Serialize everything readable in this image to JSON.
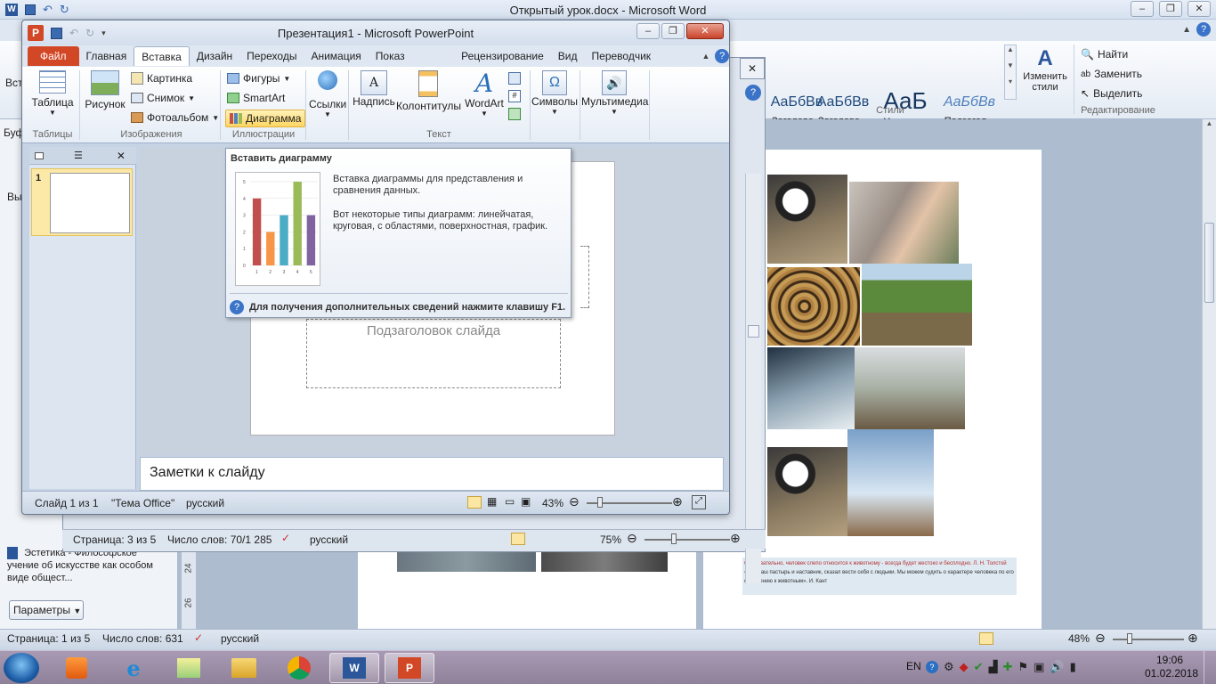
{
  "word": {
    "title": "Открытый урок.docx  -  Microsoft Word",
    "styles": [
      {
        "sample": "АаБбВв",
        "label": "Заголово..."
      },
      {
        "sample": "АаБбВв",
        "label": "Заголово..."
      },
      {
        "sample": "АаБ",
        "label": "Название"
      },
      {
        "sample": "АаБбВв",
        "label": "Подзагол..."
      }
    ],
    "styles_group": "Стили",
    "change_styles": "Изменить стили",
    "edit_group": "Редактирование",
    "find": "Найти",
    "replace": "Заменить",
    "select": "Выделить",
    "left_partial_1": "Вст",
    "left_partial_2": "Буф",
    "left_partial_3": "Вы",
    "nav_item": "Эстетика - Философское учение об искусстве как особом виде общест...",
    "params_button": "Параметры",
    "ruler_marks": [
      "24",
      "26"
    ],
    "quote_line1": "Следовательно, человек слепо относится к животному - всегда будет жестоко и бесплодно. Л. Н. Толстой",
    "quote_line2": "«Бог, наш пастырь и наставник, сказал вести себя с людьми. Мы можем судить о характере человека по его отношению к животным». И. Кант",
    "status": {
      "page": "Страница: 1 из 5",
      "words": "Число слов: 631",
      "lang": "русский",
      "zoom": "48%"
    }
  },
  "mid_word": {
    "status": {
      "page": "Страница: 3 из 5",
      "words": "Число слов: 70/1 285",
      "lang": "русский",
      "zoom": "75%"
    }
  },
  "ppt": {
    "title": "Презентация1  -  Microsoft PowerPoint",
    "app_letter": "P",
    "tabs": [
      "Файл",
      "Главная",
      "Вставка",
      "Дизайн",
      "Переходы",
      "Анимация",
      "Показ слайдов",
      "Рецензирование",
      "Вид",
      "Переводчик PROMT"
    ],
    "active_tab": "Вставка",
    "ribbon": {
      "table": "Таблица",
      "tables_group": "Таблицы",
      "picture": "Рисунок",
      "clipart": "Картинка",
      "screenshot": "Снимок",
      "photoalbum": "Фотоальбом",
      "images_group": "Изображения",
      "shapes": "Фигуры",
      "smartart": "SmartArt",
      "chart": "Диаграмма",
      "illustrations_group": "Иллюстрации",
      "links": "Ссылки",
      "textbox": "Надпись",
      "headerfooter": "Колонтитулы",
      "wordart": "WordArt",
      "text_group": "Текст",
      "symbols": "Символы",
      "media": "Мультимедиа"
    },
    "slide_number": "1",
    "subtitle_placeholder": "Подзаголовок слайда",
    "notes_placeholder": "Заметки к слайду",
    "status": {
      "slide": "Слайд 1 из 1",
      "theme": "\"Тема Office\"",
      "lang": "русский",
      "zoom": "43%"
    }
  },
  "tooltip": {
    "title": "Вставить диаграмму",
    "desc": "Вставка диаграммы для представления и сравнения данных.",
    "types": "Вот некоторые типы диаграмм: линейчатая, круговая, с областями, поверхностная, график.",
    "help": "Для получения дополнительных сведений нажмите клавишу F1."
  },
  "chart_data": {
    "type": "bar",
    "categories": [
      "1",
      "2",
      "3",
      "4",
      "5"
    ],
    "values": [
      4,
      2,
      3,
      5,
      3
    ],
    "ylim": [
      0,
      5
    ],
    "y_ticks": [
      "0",
      "1",
      "2",
      "3",
      "4",
      "5"
    ],
    "colors": [
      "#c0504d",
      "#f79646",
      "#4bacc6",
      "#9bbb59",
      "#8064a2"
    ]
  },
  "taskbar": {
    "lang": "EN",
    "time": "19:06",
    "date": "01.02.2018"
  },
  "colors": {
    "ppt_accent": "#d24726",
    "word_accent": "#2b579a"
  }
}
